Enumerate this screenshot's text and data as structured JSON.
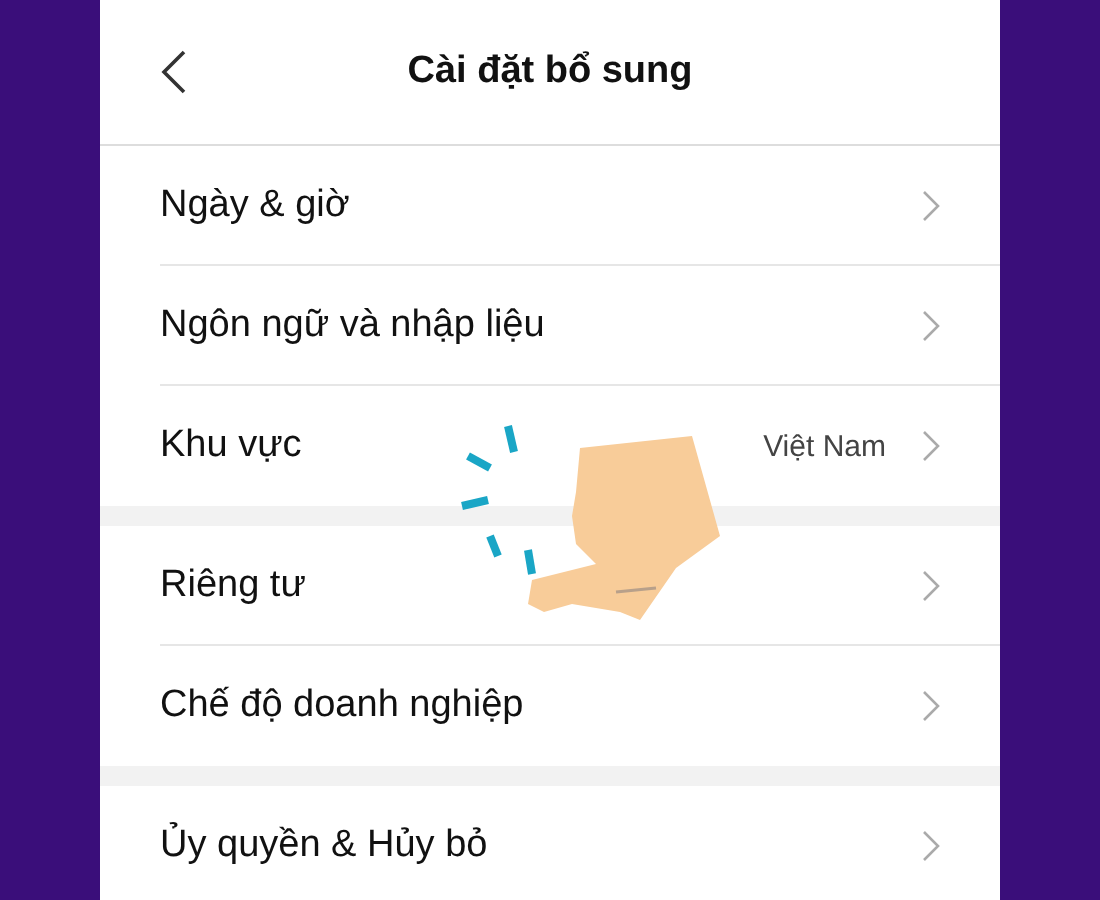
{
  "header": {
    "title": "Cài đặt bổ sung"
  },
  "groups": [
    {
      "rows": [
        {
          "label": "Ngày & giờ"
        },
        {
          "label": "Ngôn ngữ và nhập liệu"
        },
        {
          "label": "Khu vực",
          "value": "Việt Nam"
        }
      ]
    },
    {
      "rows": [
        {
          "label": "Riêng tư"
        },
        {
          "label": "Chế độ doanh nghiệp"
        }
      ]
    },
    {
      "rows": [
        {
          "label": "Ủy quyền & Hủy bỏ"
        }
      ]
    }
  ]
}
